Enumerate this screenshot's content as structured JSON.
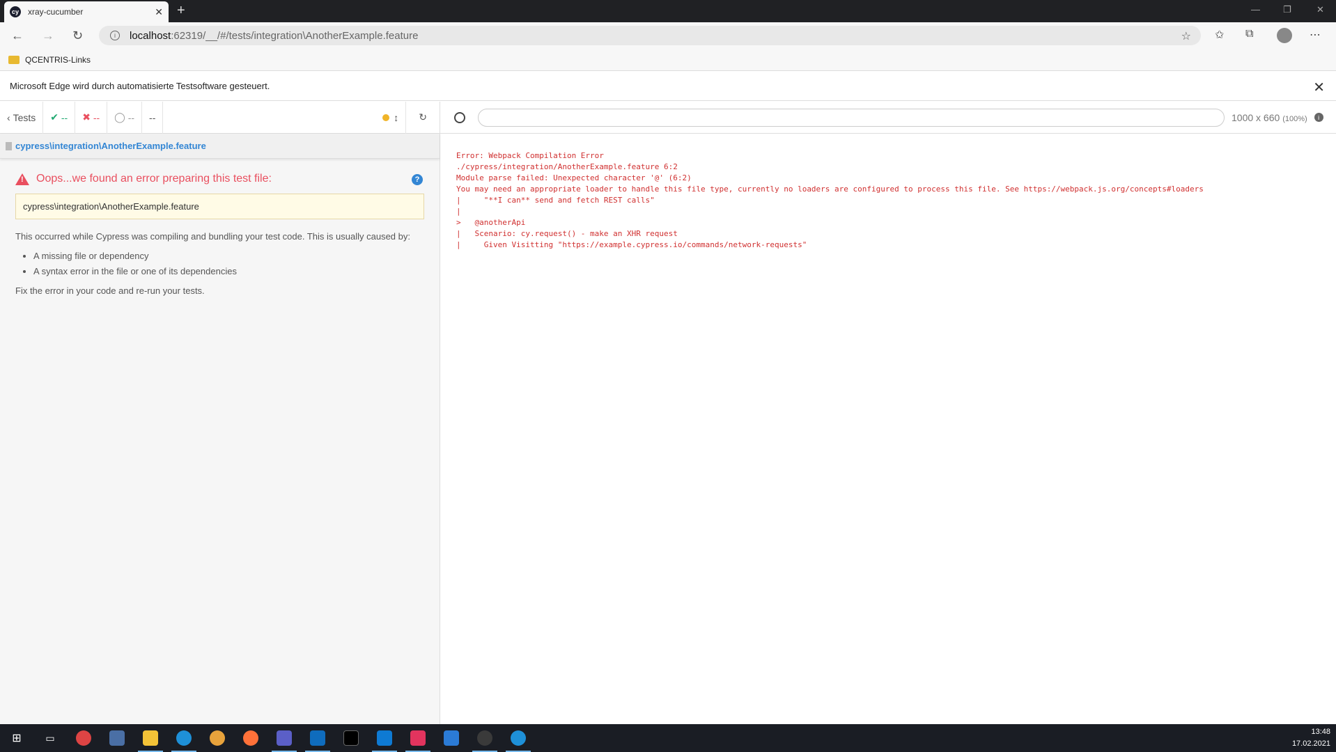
{
  "browser": {
    "tab_title": "xray-cucumber",
    "tab_favicon": "cy",
    "new_tab": "+",
    "url_host": "localhost",
    "url_path": ":62319/__/#/tests/integration\\AnotherExample.feature",
    "bookmark": "QCENTRIS-Links",
    "automation_notice": "Microsoft Edge wird durch automatisierte Testsoftware gesteuert."
  },
  "reporter": {
    "back_label": "Tests",
    "passed": "--",
    "failed": "--",
    "pending": "--",
    "duration": "--",
    "spec_path": "cypress\\integration\\AnotherExample.feature",
    "error_title": "Oops...we found an error preparing this test file:",
    "error_file": "cypress\\integration\\AnotherExample.feature",
    "description": "This occurred while Cypress was compiling and bundling your test code. This is usually caused by:",
    "causes": [
      "A missing file or dependency",
      "A syntax error in the file or one of its dependencies"
    ],
    "fix": "Fix the error in your code and re-run your tests."
  },
  "aut": {
    "viewport": "1000 x 660",
    "scale": "(100%)",
    "error_text": "Error: Webpack Compilation Error\n./cypress/integration/AnotherExample.feature 6:2\nModule parse failed: Unexpected character '@' (6:2)\nYou may need an appropriate loader to handle this file type, currently no loaders are configured to process this file. See https://webpack.js.org/concepts#loaders\n|     \"**I can** send and fetch REST calls\"\n|\n>   @anotherApi\n|   Scenario: cy.request() - make an XHR request\n|     Given Visitting \"https://example.cypress.io/commands/network-requests\""
  },
  "taskbar": {
    "time": "13:48",
    "date": "17.02.2021"
  },
  "colors": {
    "error_red": "#e94f5f",
    "pass_green": "#1fa971",
    "link_blue": "#3386d4"
  }
}
